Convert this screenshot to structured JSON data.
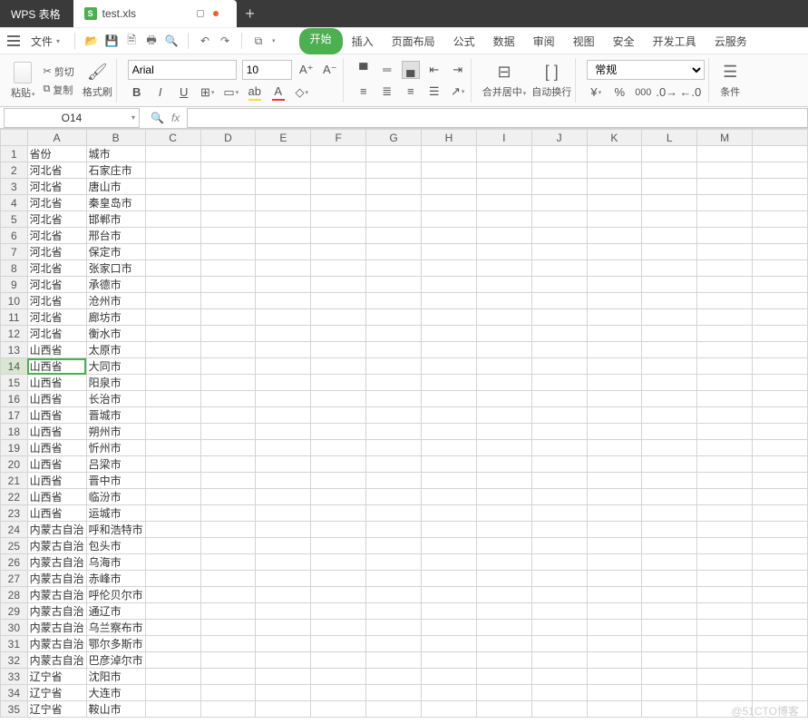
{
  "app": {
    "name": "WPS 表格"
  },
  "tab": {
    "icon_letter": "S",
    "filename": "test.xls"
  },
  "menubar": {
    "file_label": "文件",
    "tabs": [
      "开始",
      "插入",
      "页面布局",
      "公式",
      "数据",
      "审阅",
      "视图",
      "安全",
      "开发工具",
      "云服务"
    ],
    "active_tab_index": 0
  },
  "ribbon": {
    "paste_label": "粘贴",
    "cut_label": "剪切",
    "copy_label": "复制",
    "format_painter_label": "格式刷",
    "font_name": "Arial",
    "font_size": "10",
    "merge_label": "合并居中",
    "wrap_label": "自动换行",
    "number_format": "常规",
    "conditional_label": "条件"
  },
  "namebox": {
    "value": "O14"
  },
  "formula": {
    "value": ""
  },
  "columns": [
    "A",
    "B",
    "C",
    "D",
    "E",
    "F",
    "G",
    "H",
    "I",
    "J",
    "K",
    "L",
    "M"
  ],
  "selected": {
    "row": 14,
    "col": "A",
    "cell_ref": "A14"
  },
  "rows": [
    {
      "n": 1,
      "a": "省份",
      "b": "城市"
    },
    {
      "n": 2,
      "a": "河北省",
      "b": "石家庄市"
    },
    {
      "n": 3,
      "a": "河北省",
      "b": "唐山市"
    },
    {
      "n": 4,
      "a": "河北省",
      "b": "秦皇岛市"
    },
    {
      "n": 5,
      "a": "河北省",
      "b": "邯郸市"
    },
    {
      "n": 6,
      "a": "河北省",
      "b": "邢台市"
    },
    {
      "n": 7,
      "a": "河北省",
      "b": "保定市"
    },
    {
      "n": 8,
      "a": "河北省",
      "b": "张家口市"
    },
    {
      "n": 9,
      "a": "河北省",
      "b": "承德市"
    },
    {
      "n": 10,
      "a": "河北省",
      "b": "沧州市"
    },
    {
      "n": 11,
      "a": "河北省",
      "b": "廊坊市"
    },
    {
      "n": 12,
      "a": "河北省",
      "b": "衡水市"
    },
    {
      "n": 13,
      "a": "山西省",
      "b": "太原市"
    },
    {
      "n": 14,
      "a": "山西省",
      "b": "大同市"
    },
    {
      "n": 15,
      "a": "山西省",
      "b": "阳泉市"
    },
    {
      "n": 16,
      "a": "山西省",
      "b": "长治市"
    },
    {
      "n": 17,
      "a": "山西省",
      "b": "晋城市"
    },
    {
      "n": 18,
      "a": "山西省",
      "b": "朔州市"
    },
    {
      "n": 19,
      "a": "山西省",
      "b": "忻州市"
    },
    {
      "n": 20,
      "a": "山西省",
      "b": "吕梁市"
    },
    {
      "n": 21,
      "a": "山西省",
      "b": "晋中市"
    },
    {
      "n": 22,
      "a": "山西省",
      "b": "临汾市"
    },
    {
      "n": 23,
      "a": "山西省",
      "b": "运城市"
    },
    {
      "n": 24,
      "a": "内蒙古自治",
      "b": "呼和浩特市"
    },
    {
      "n": 25,
      "a": "内蒙古自治",
      "b": "包头市"
    },
    {
      "n": 26,
      "a": "内蒙古自治",
      "b": "乌海市"
    },
    {
      "n": 27,
      "a": "内蒙古自治",
      "b": "赤峰市"
    },
    {
      "n": 28,
      "a": "内蒙古自治",
      "b": "呼伦贝尔市"
    },
    {
      "n": 29,
      "a": "内蒙古自治",
      "b": "通辽市"
    },
    {
      "n": 30,
      "a": "内蒙古自治",
      "b": "乌兰察布市"
    },
    {
      "n": 31,
      "a": "内蒙古自治",
      "b": "鄂尔多斯市"
    },
    {
      "n": 32,
      "a": "内蒙古自治",
      "b": "巴彦淖尔市"
    },
    {
      "n": 33,
      "a": "辽宁省",
      "b": "沈阳市"
    },
    {
      "n": 34,
      "a": "辽宁省",
      "b": "大连市"
    },
    {
      "n": 35,
      "a": "辽宁省",
      "b": "鞍山市"
    }
  ],
  "watermark": "@51CTO博客"
}
